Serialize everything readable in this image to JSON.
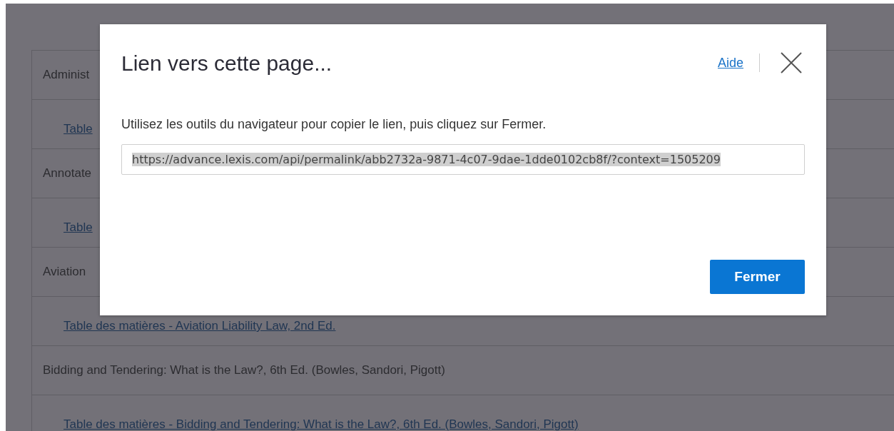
{
  "background_list": {
    "rows": [
      {
        "kind": "title",
        "text": "Administ"
      },
      {
        "kind": "link",
        "text": "Table"
      },
      {
        "kind": "title",
        "text": "Annotate"
      },
      {
        "kind": "link",
        "text": "Table"
      },
      {
        "kind": "title",
        "text": "Aviation"
      },
      {
        "kind": "link",
        "text": "Table des matières - Aviation Liability Law, 2nd Ed."
      },
      {
        "kind": "title",
        "text": "Bidding and Tendering: What is the Law?, 6th Ed. (Bowles, Sandori, Pigott)"
      },
      {
        "kind": "link",
        "text": "Table des matières - Bidding and Tendering: What is the Law?, 6th Ed. (Bowles, Sandori, Pigott)"
      }
    ]
  },
  "dialog": {
    "title": "Lien vers cette page...",
    "help_link": "Aide",
    "message": "Utilisez les outils du navigateur pour copier le lien, puis cliquez sur Fermer.",
    "link_field": {
      "value": "https://advance.lexis.com/api/permalink/abb2732a-9871-4c07-9dae-1dde0102cb8f/?context=1505209",
      "selected": true
    },
    "buttons": [
      "Fermer"
    ]
  }
}
